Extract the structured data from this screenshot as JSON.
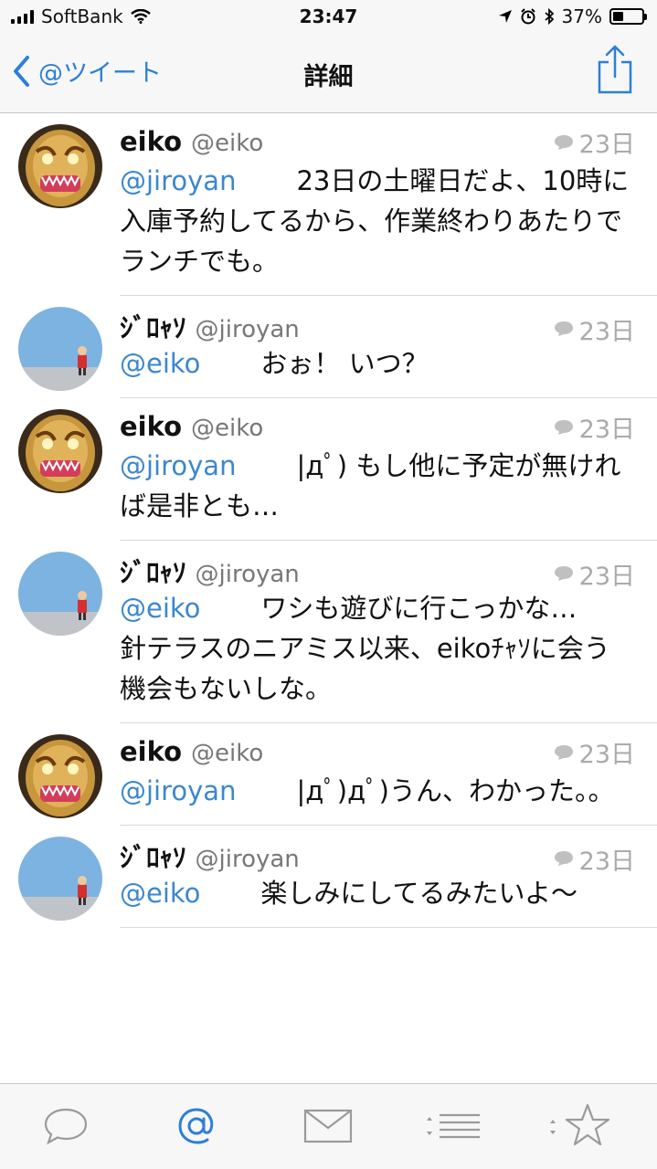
{
  "status": {
    "carrier": "SoftBank",
    "time": "23:47",
    "battery_percent": "37%",
    "battery_level": 0.37
  },
  "nav": {
    "back_label": "@ツイート",
    "title": "詳細"
  },
  "tweets": [
    {
      "name": "eiko",
      "handle": "@eiko",
      "date": "23日",
      "mention": "@jiroyan",
      "text": "23日の土曜日だよ、10時に入庫予約してるから、作業終わりあたりでランチでも。"
    },
    {
      "name": "ｼﾞﾛｬｿ",
      "handle": "@jiroyan",
      "date": "23日",
      "mention": "@eiko",
      "text": "おぉ！ いつ？"
    },
    {
      "name": "eiko",
      "handle": "@eiko",
      "date": "23日",
      "mention": "@jiroyan",
      "text": "|дﾟ) もし他に予定が無ければ是非とも…"
    },
    {
      "name": "ｼﾞﾛｬｿ",
      "handle": "@jiroyan",
      "date": "23日",
      "mention": "@eiko",
      "text": "ワシも遊びに行こっかな…\n針テラスのニアミス以来、eikoﾁｬｿに会う機会もないしな。"
    },
    {
      "name": "eiko",
      "handle": "@eiko",
      "date": "23日",
      "mention": "@jiroyan",
      "text": "|дﾟ)дﾟ)うん、わかった。。"
    },
    {
      "name": "ｼﾞﾛｬｿ",
      "handle": "@jiroyan",
      "date": "23日",
      "mention": "@eiko",
      "text": "楽しみにしてるみたいよ〜"
    }
  ],
  "tabs": [
    "speech-bubble-icon",
    "at-sign-icon",
    "mail-icon",
    "list-icon",
    "star-icon"
  ],
  "colors": {
    "accent": "#2d7fd8",
    "mention": "#3b87cf",
    "muted": "#aaaaaa"
  }
}
